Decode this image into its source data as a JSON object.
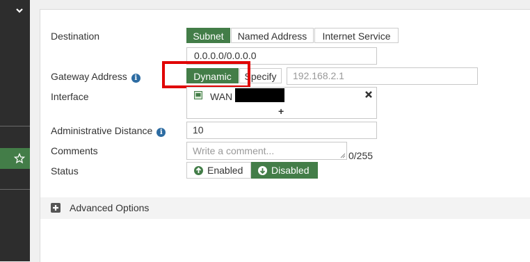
{
  "form": {
    "destination": {
      "label": "Destination",
      "options": [
        "Subnet",
        "Named Address",
        "Internet Service"
      ],
      "selected": "Subnet",
      "value": "0.0.0.0/0.0.0.0"
    },
    "gateway": {
      "label": "Gateway Address",
      "options": [
        "Dynamic",
        "Specify"
      ],
      "selected": "Dynamic",
      "placeholder": "192.168.2.1"
    },
    "interface": {
      "label": "Interface",
      "value": "WAN"
    },
    "admin_distance": {
      "label": "Administrative Distance",
      "value": "10"
    },
    "comments": {
      "label": "Comments",
      "placeholder": "Write a comment...",
      "counter": "0/255"
    },
    "status": {
      "label": "Status",
      "enabled": "Enabled",
      "disabled": "Disabled",
      "selected": "Disabled"
    },
    "advanced": {
      "label": "Advanced Options"
    }
  },
  "colors": {
    "accent": "#437d48",
    "sidebar": "#2d2d2d",
    "highlight": "#e00000",
    "info": "#2d6ca2"
  },
  "icons": [
    "chevron-down-icon",
    "star-icon",
    "info-icon",
    "network-icon",
    "close-icon",
    "plus-icon",
    "arrow-up-circle-icon",
    "arrow-down-circle-icon",
    "expand-icon"
  ]
}
